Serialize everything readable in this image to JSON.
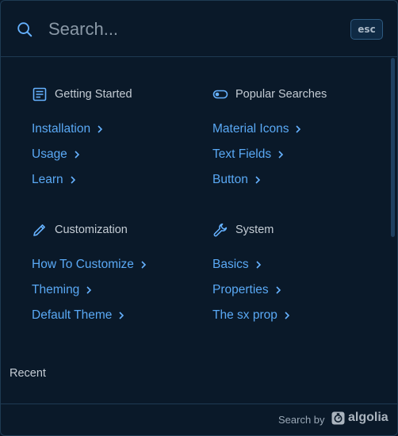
{
  "search": {
    "placeholder": "Search...",
    "esc_label": "esc"
  },
  "sections": [
    {
      "title": "Getting Started",
      "icon": "article-icon",
      "links": [
        {
          "label": "Installation"
        },
        {
          "label": "Usage"
        },
        {
          "label": "Learn"
        }
      ]
    },
    {
      "title": "Popular Searches",
      "icon": "toggle-icon",
      "links": [
        {
          "label": "Material Icons"
        },
        {
          "label": "Text Fields"
        },
        {
          "label": "Button"
        }
      ]
    },
    {
      "title": "Customization",
      "icon": "pencil-icon",
      "links": [
        {
          "label": "How To Customize"
        },
        {
          "label": "Theming"
        },
        {
          "label": "Default Theme"
        }
      ]
    },
    {
      "title": "System",
      "icon": "wrench-icon",
      "links": [
        {
          "label": "Basics"
        },
        {
          "label": "Properties"
        },
        {
          "label": "The sx prop"
        }
      ]
    }
  ],
  "recent": {
    "label": "Recent"
  },
  "footer": {
    "search_by": "Search by",
    "brand": "algolia"
  },
  "colors": {
    "background": "#0a1929",
    "link": "#5aa9f5",
    "icon": "#66b2ff",
    "border": "#1e3a52"
  }
}
